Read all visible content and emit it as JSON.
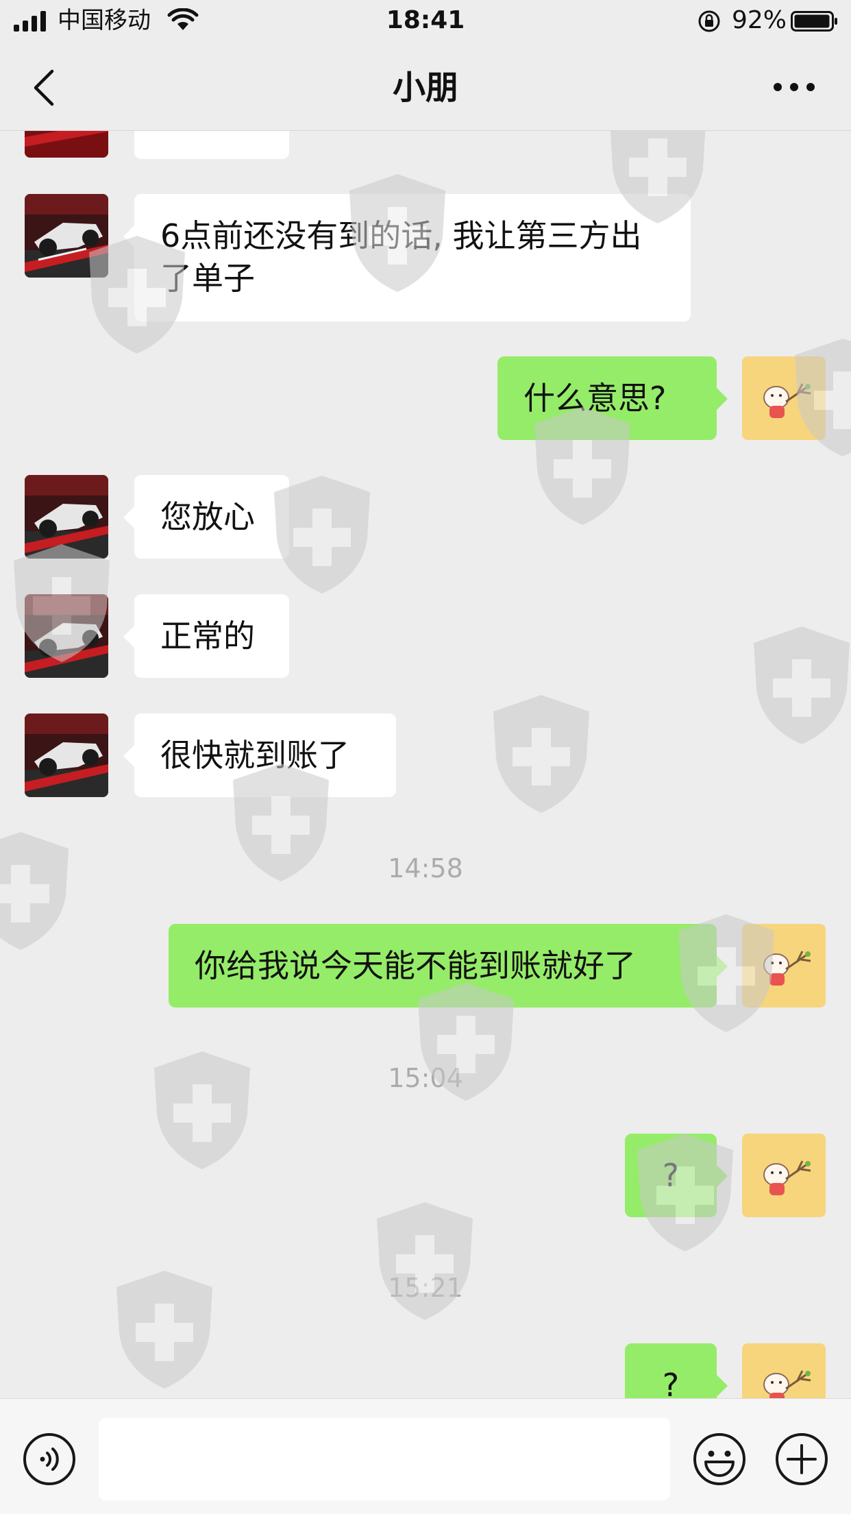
{
  "status_bar": {
    "carrier": "中国移动",
    "time": "18:41",
    "battery_percent": "92%"
  },
  "nav": {
    "title": "小朋"
  },
  "messages": [
    {
      "from": "contact",
      "text": ""
    },
    {
      "from": "contact",
      "text": "6点前还没有到的话, 我让第三方出了单子"
    },
    {
      "from": "me",
      "text": "什么意思?"
    },
    {
      "from": "contact",
      "text": "您放心"
    },
    {
      "from": "contact",
      "text": "正常的"
    },
    {
      "from": "contact",
      "text": "很快就到账了"
    },
    {
      "timestamp": "14:58"
    },
    {
      "from": "me",
      "text": "你给我说今天能不能到账就好了"
    },
    {
      "timestamp": "15:04"
    },
    {
      "from": "me",
      "text": "?"
    },
    {
      "timestamp": "15:21"
    },
    {
      "from": "me",
      "text": "?"
    }
  ],
  "icons": {
    "contact_avatar": "race-car-avatar",
    "my_avatar": "cartoon-pig-avatar",
    "watermark": "shield-cross-watermark"
  },
  "colors": {
    "incoming_bubble": "#ffffff",
    "outgoing_bubble": "#95ec69",
    "background": "#ededed",
    "timestamp_text": "#ababab"
  }
}
